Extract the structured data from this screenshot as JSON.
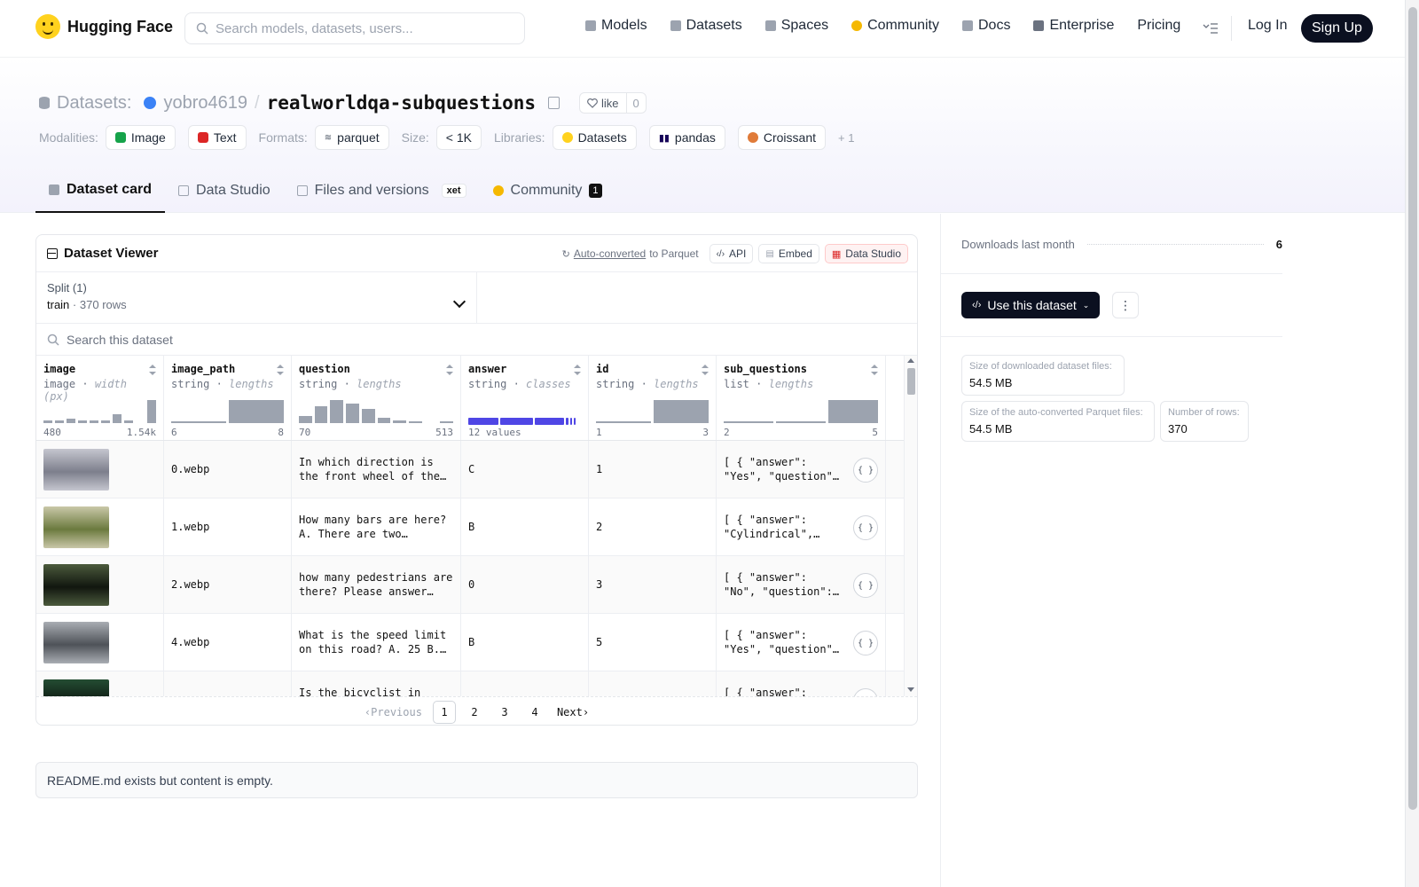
{
  "nav": {
    "brand": "Hugging Face",
    "search_placeholder": "Search models, datasets, users...",
    "items": [
      {
        "label": "Models",
        "icon": "cube-icon",
        "color": "#9ca3af"
      },
      {
        "label": "Datasets",
        "icon": "database-icon",
        "color": "#9ca3af"
      },
      {
        "label": "Spaces",
        "icon": "grid-icon",
        "color": "#9ca3af"
      },
      {
        "label": "Community",
        "icon": "community-icon",
        "color": "#f5b800"
      },
      {
        "label": "Docs",
        "icon": "book-icon",
        "color": "#9ca3af"
      },
      {
        "label": "Enterprise",
        "icon": "enterprise-icon",
        "color": "#6b7280"
      },
      {
        "label": "Pricing",
        "icon": "",
        "color": ""
      }
    ],
    "login": "Log In",
    "signup": "Sign Up"
  },
  "header": {
    "prefix": "Datasets:",
    "owner": "yobro4619",
    "slash": "/",
    "repo": "realworldqa-subquestions",
    "like_label": "like",
    "like_count": "0",
    "modalities_label": "Modalities:",
    "modalities": [
      "Image",
      "Text"
    ],
    "formats_label": "Formats:",
    "format": "parquet",
    "size_label": "Size:",
    "size": "< 1K",
    "libraries_label": "Libraries:",
    "libraries": [
      "Datasets",
      "pandas",
      "Croissant"
    ],
    "more": "+ 1"
  },
  "tabs": [
    {
      "label": "Dataset card",
      "active": true
    },
    {
      "label": "Data Studio",
      "active": false
    },
    {
      "label": "Files and versions",
      "active": false,
      "badge": "xet"
    },
    {
      "label": "Community",
      "active": false,
      "count": "1"
    }
  ],
  "viewer": {
    "title": "Dataset Viewer",
    "auto_converted": "Auto-converted",
    "to_parquet": "to Parquet",
    "api": "API",
    "embed": "Embed",
    "data_studio": "Data Studio",
    "split_label": "Split (1)",
    "split_name": "train",
    "split_sep": "·",
    "split_rows": "370 rows",
    "search_placeholder": "Search this dataset",
    "columns": [
      {
        "name": "image",
        "type": "image",
        "stat": "width (px)",
        "min": "480",
        "max": "1.54k",
        "hist": [
          0.1,
          0.1,
          0.18,
          0.1,
          0.1,
          0.1,
          0.4,
          0.1,
          0,
          1
        ]
      },
      {
        "name": "image_path",
        "type": "string",
        "stat": "lengths",
        "min": "6",
        "max": "8",
        "hist": [
          0.05,
          1
        ]
      },
      {
        "name": "question",
        "type": "string",
        "stat": "lengths",
        "min": "70",
        "max": "513",
        "hist": [
          0.3,
          0.75,
          1,
          0.85,
          0.6,
          0.25,
          0.12,
          0.05,
          0,
          0.06
        ]
      },
      {
        "name": "answer",
        "type": "string",
        "stat": "classes",
        "min": "12 values",
        "max": "",
        "classes": [
          0.3,
          0.33,
          0.29,
          0.02,
          0.02,
          0.02
        ]
      },
      {
        "name": "id",
        "type": "string",
        "stat": "lengths",
        "min": "1",
        "max": "3",
        "hist": [
          0.05,
          1
        ]
      },
      {
        "name": "sub_questions",
        "type": "list",
        "stat": "lengths",
        "min": "2",
        "max": "5",
        "hist": [
          0.05,
          0.05,
          1
        ]
      }
    ],
    "rows": [
      {
        "image_path": "0.webp",
        "question": "In which direction is the front wheel of the car o…",
        "answer": "C",
        "id": "1",
        "sub_questions": "[ { \"answer\": \"Yes\", \"question\": \"Is…",
        "thumb": [
          "#7d7f8c",
          "#c5c6cf"
        ]
      },
      {
        "image_path": "1.webp",
        "question": "How many bars are here? A. There are two paralle…",
        "answer": "B",
        "id": "2",
        "sub_questions": "[ { \"answer\": \"Cylindrical\",…",
        "thumb": [
          "#6b7a3e",
          "#c9c7a8"
        ]
      },
      {
        "image_path": "2.webp",
        "question": "how many pedestrians are there? Please answer…",
        "answer": "0",
        "id": "3",
        "sub_questions": "[ { \"answer\": \"No\", \"question\": \"Are…",
        "thumb": [
          "#11160f",
          "#4b5a3c"
        ]
      },
      {
        "image_path": "4.webp",
        "question": "What is the speed limit on this road? A. 25 B. 3…",
        "answer": "B",
        "id": "5",
        "sub_questions": "[ { \"answer\": \"Yes\", \"question\": \"Is…",
        "thumb": [
          "#4e5258",
          "#a9adb3"
        ]
      },
      {
        "image_path": "",
        "question": "Is the bicyclist in this…",
        "answer": "",
        "id": "",
        "sub_questions": "[ { \"answer\": \"Right…",
        "thumb": [
          "#0e1a12",
          "#244d33"
        ]
      }
    ],
    "pager": {
      "prev": "Previous",
      "pages": [
        "1",
        "2",
        "3",
        "4"
      ],
      "next": "Next"
    }
  },
  "readme": "README.md exists but content is empty.",
  "sidebar": {
    "downloads_label": "Downloads last month",
    "downloads": "6",
    "use_dataset": "Use this dataset",
    "stats": [
      {
        "label": "Size of downloaded dataset files:",
        "value": "54.5 MB"
      },
      {
        "label": "Size of the auto-converted Parquet files:",
        "value": "54.5 MB"
      },
      {
        "label": "Number of rows:",
        "value": "370"
      }
    ]
  },
  "colors": {
    "brand": "#ffd21e",
    "dark": "#0b1020",
    "accent": "#4f46e5"
  }
}
